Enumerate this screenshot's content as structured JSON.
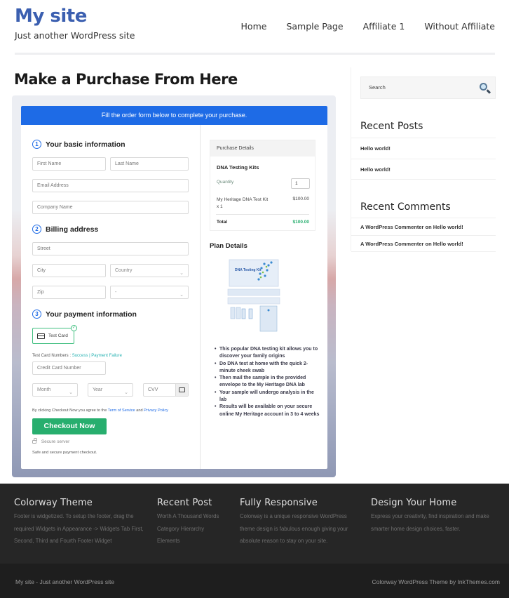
{
  "site": {
    "title": "My site",
    "tagline": "Just another WordPress site",
    "brand_color": "#3b5fb0"
  },
  "nav": {
    "items": [
      {
        "label": "Home"
      },
      {
        "label": "Sample Page"
      },
      {
        "label": "Affiliate 1"
      },
      {
        "label": "Without Affiliate"
      }
    ]
  },
  "page": {
    "title": "Make a Purchase From Here"
  },
  "form": {
    "banner": "Fill the order form below to complete your purchase.",
    "banner_color": "#1e6be6",
    "step1": {
      "num": "1",
      "title": "Your basic information"
    },
    "step2": {
      "num": "2",
      "title": "Billing address"
    },
    "step3": {
      "num": "3",
      "title": "Your payment information"
    },
    "placeholders": {
      "first_name": "First Name",
      "last_name": "Last Name",
      "email": "Email Address",
      "company": "Company Name",
      "street": "Street",
      "city": "City",
      "country": "Country",
      "zip": "Zip",
      "state": "-",
      "card_number": "Credit Card Number",
      "month": "Month",
      "year": "Year",
      "cvv": "CVV"
    },
    "payment_method": "Test Card",
    "test_numbers_label": "Test Card Numbers :",
    "test_success": "Success",
    "test_separator": "|",
    "test_failure": "Payment Failure",
    "agree_prefix": "By clicking Checkout Now you agree to the",
    "terms_link": "Term of Service",
    "agree_and": "and",
    "privacy_link": "Privacy Policy",
    "checkout_label": "Checkout Now",
    "checkout_color": "#27ae6e",
    "secure_label": "Secure server",
    "safe_label": "Safe and secure payment checkout."
  },
  "purchase": {
    "header": "Purchase Details",
    "product_group": "DNA Testing Kits",
    "quantity_label": "Quantity",
    "quantity_value": "1",
    "item_name_line1": "My Heritage DNA Test Kit",
    "item_name_line2": "x 1",
    "item_price": "$100.00",
    "total_label": "Total",
    "total_value": "$100.00",
    "total_color": "#27ae6e"
  },
  "plan": {
    "title": "Plan Details",
    "image_label": "DNA Testing Kit",
    "bullets": [
      "This popular DNA testing kit allows you to discover your family origins",
      "Do DNA test at home with the quick 2-minute cheek swab",
      "Then mail the sample in the provided envelope to the My Heritage DNA lab",
      "Your sample will undergo analysis in the lab",
      "Results will be available on your secure online My Heritage account in 3 to 4 weeks"
    ]
  },
  "sidebar": {
    "search_placeholder": "Search",
    "recent_posts_title": "Recent Posts",
    "recent_posts": [
      "Hello world!",
      "Hello world!"
    ],
    "recent_comments_title": "Recent Comments",
    "recent_comments": [
      "A WordPress Commenter on Hello world!",
      "A WordPress Commenter on Hello world!"
    ]
  },
  "footer": {
    "columns": [
      {
        "title": "Colorway Theme",
        "text": "Footer is widgetized. To setup the footer, drag the required Widgets in Appearance -> Widgets Tab First, Second, Third and Fourth Footer Widget"
      },
      {
        "title": "Recent Post",
        "links": [
          "Worth A Thousand Words",
          "Category Hierarchy",
          "Elements"
        ]
      },
      {
        "title": "Fully Responsive",
        "text": "Colorway is a unique responsive WordPress theme design is fabulous enough giving your absolute reason to stay on your site."
      },
      {
        "title": "Design Your Home",
        "text": "Express your creativity, find inspiration and make smarter home design choices, faster."
      }
    ],
    "bottom_left": "My site - Just another WordPress site",
    "bottom_right": "Colorway WordPress Theme by InkThemes.com"
  }
}
